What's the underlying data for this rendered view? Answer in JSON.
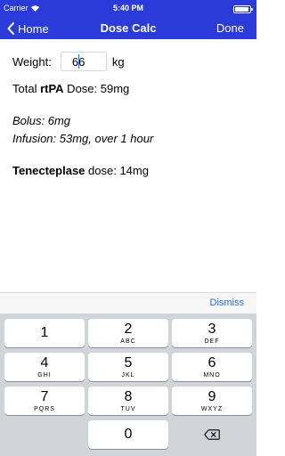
{
  "status": {
    "carrier": "Carrier",
    "time": "5:40 PM"
  },
  "nav": {
    "back_label": "Home",
    "title": "Dose Calc",
    "done_label": "Done"
  },
  "form": {
    "weight_label": "Weight:",
    "weight_value": "66",
    "weight_unit": "kg"
  },
  "results": {
    "total_prefix": "Total ",
    "total_drug": "rtPA",
    "total_suffix": " Dose: 59mg",
    "bolus": "Bolus: 6mg",
    "infusion": "Infusion: 53mg, over 1 hour",
    "tenect_drug": "Tenecteplase",
    "tenect_suffix": " dose: 14mg"
  },
  "keyboard": {
    "dismiss_label": "Dismiss",
    "keys": [
      {
        "num": "1",
        "letters": ""
      },
      {
        "num": "2",
        "letters": "ABC"
      },
      {
        "num": "3",
        "letters": "DEF"
      },
      {
        "num": "4",
        "letters": "GHI"
      },
      {
        "num": "5",
        "letters": "JKL"
      },
      {
        "num": "6",
        "letters": "MNO"
      },
      {
        "num": "7",
        "letters": "PQRS"
      },
      {
        "num": "8",
        "letters": "TUV"
      },
      {
        "num": "9",
        "letters": "WXYZ"
      },
      {
        "num": "0",
        "letters": ""
      }
    ],
    "delete_icon": "backspace-icon"
  },
  "colors": {
    "nav_bg": "#2b3bd9",
    "accent": "#2b6cf0",
    "keyboard_bg": "#d1d4d9"
  }
}
